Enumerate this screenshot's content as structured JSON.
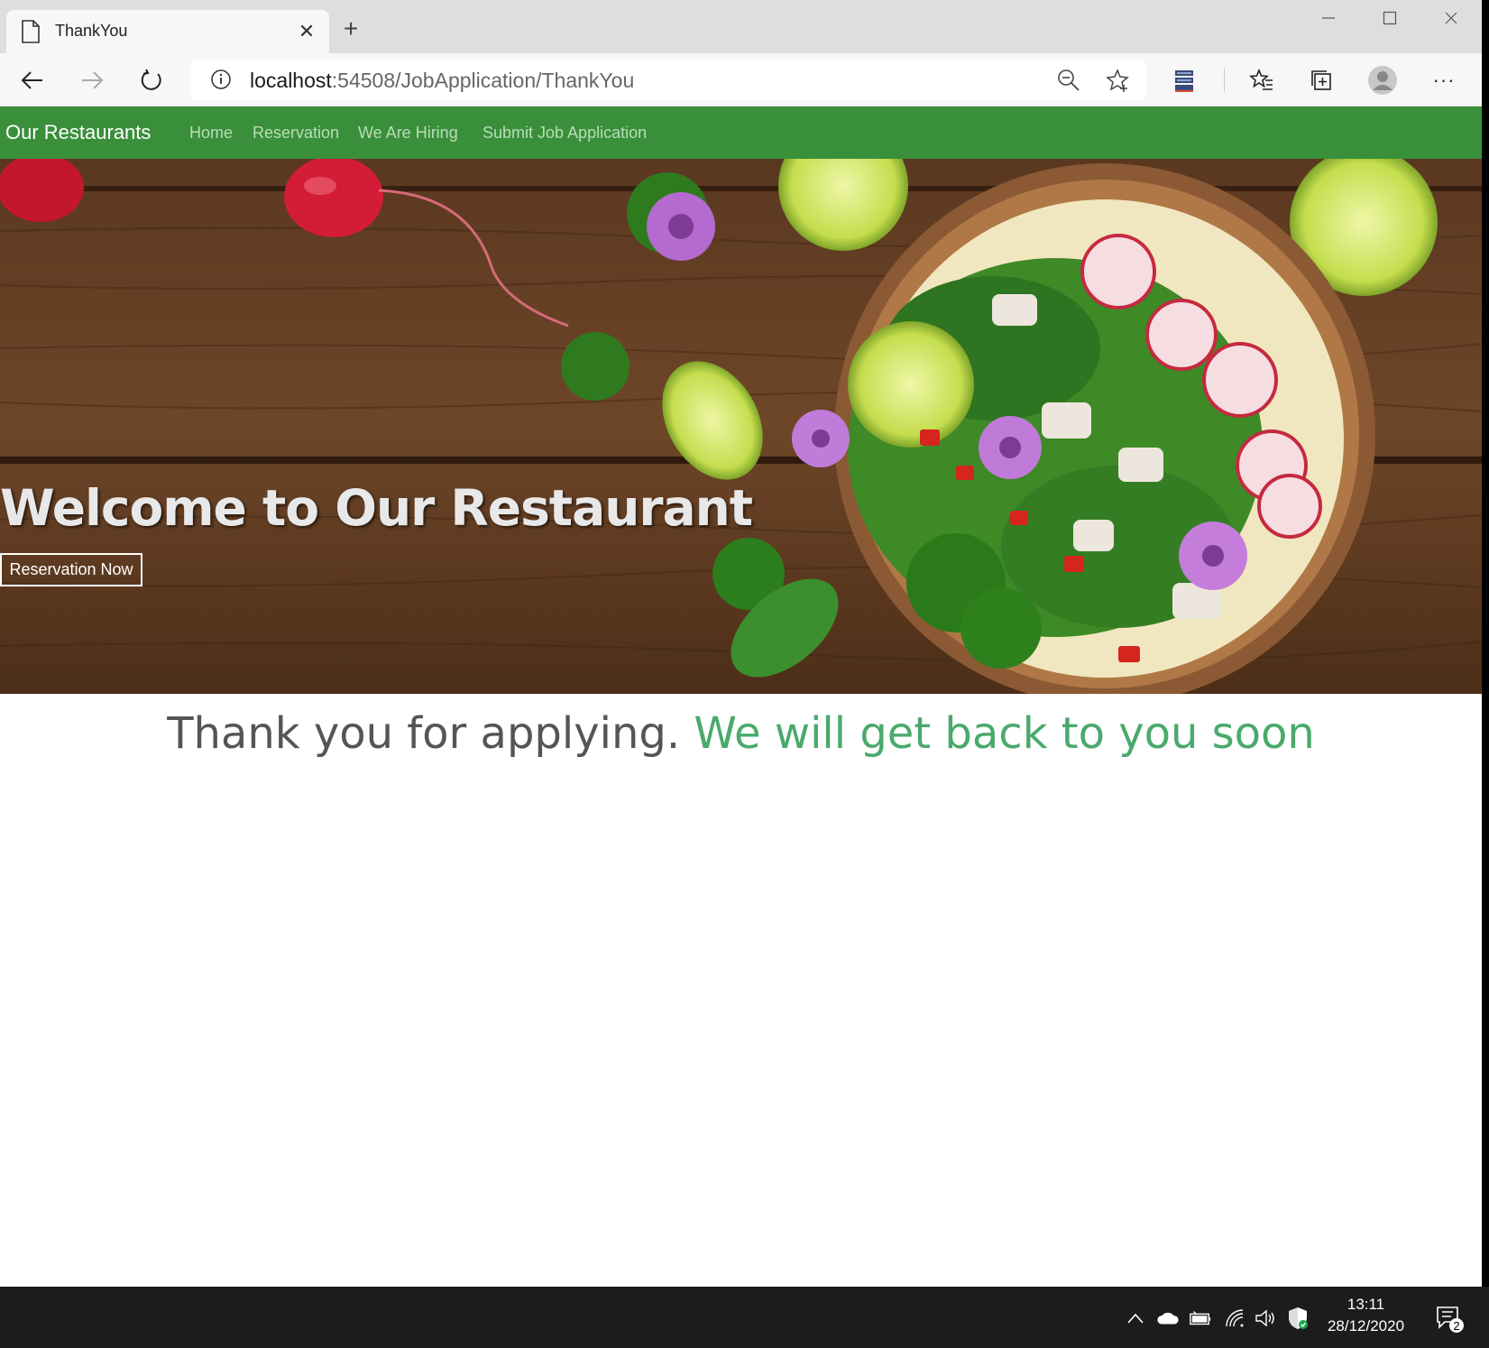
{
  "browser": {
    "tab_title": "ThankYou",
    "new_tab": "+",
    "url_host": "localhost",
    "url_rest": ":54508/JobApplication/ThankYou",
    "window_controls": [
      "minimize",
      "maximize",
      "close"
    ],
    "toolbar_icons": [
      "back-icon",
      "forward-icon",
      "refresh-icon",
      "info-icon",
      "zoom-icon",
      "favorite-add-icon",
      "extension-icon",
      "favorites-icon",
      "collections-icon",
      "profile-icon",
      "more-icon"
    ],
    "more": "···"
  },
  "site": {
    "brand": "Our Restaurants",
    "nav": [
      "Home",
      "Reservation",
      "We Are Hiring",
      "Submit Job Application"
    ],
    "colors": {
      "nav_bg": "#3a8f3a",
      "nav_link": "#b9ddb9",
      "accent_green": "#4aa96c",
      "body_text": "#555555"
    }
  },
  "hero": {
    "title": "Welcome to Our Restaurant",
    "button": "Reservation Now"
  },
  "message": {
    "part1": "Thank you for applying.",
    "part2": "We will get back to you soon"
  },
  "taskbar": {
    "time": "13:11",
    "date": "28/12/2020",
    "notifications": "2",
    "tray_icons": [
      "chevron-up-icon",
      "cloud-icon",
      "battery-icon",
      "wifi-icon",
      "volume-icon",
      "security-icon"
    ]
  }
}
